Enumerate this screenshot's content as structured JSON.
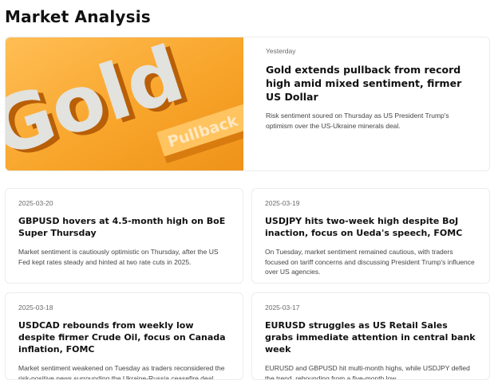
{
  "page": {
    "title": "Market Analysis"
  },
  "featured": {
    "date": "Yesterday",
    "title": "Gold extends pullback from record high amid mixed sentiment, firmer US Dollar",
    "summary": "Risk sentiment soured on Thursday as US President Trump's optimism over the US-Ukraine minerals deal.",
    "image": {
      "big_word": "Gold",
      "sign_word": "Pullback"
    }
  },
  "articles": [
    {
      "date": "2025-03-20",
      "title": "GBPUSD hovers at 4.5-month high on BoE Super Thursday",
      "summary": "Market sentiment is cautiously optimistic on Thursday, after the US Fed kept rates steady and hinted at two rate cuts in 2025."
    },
    {
      "date": "2025-03-19",
      "title": "USDJPY hits two-week high despite BoJ inaction, focus on Ueda's speech, FOMC",
      "summary": "On Tuesday, market sentiment remained cautious, with traders focused on tariff concerns and discussing President Trump's influence over US agencies."
    },
    {
      "date": "2025-03-18",
      "title": "USDCAD rebounds from weekly low despite firmer Crude Oil, focus on Canada inflation, FOMC",
      "summary": "Market sentiment weakened on Tuesday as traders reconsidered the risk-positive news surrounding the Ukraine-Russia ceasefire deal."
    },
    {
      "date": "2025-03-17",
      "title": "EURUSD struggles as US Retail Sales grabs immediate attention in central bank week",
      "summary": "EURUSD and GBPUSD hit multi-month highs, while USDJPY defied the trend, rebounding from a five-month low."
    }
  ]
}
